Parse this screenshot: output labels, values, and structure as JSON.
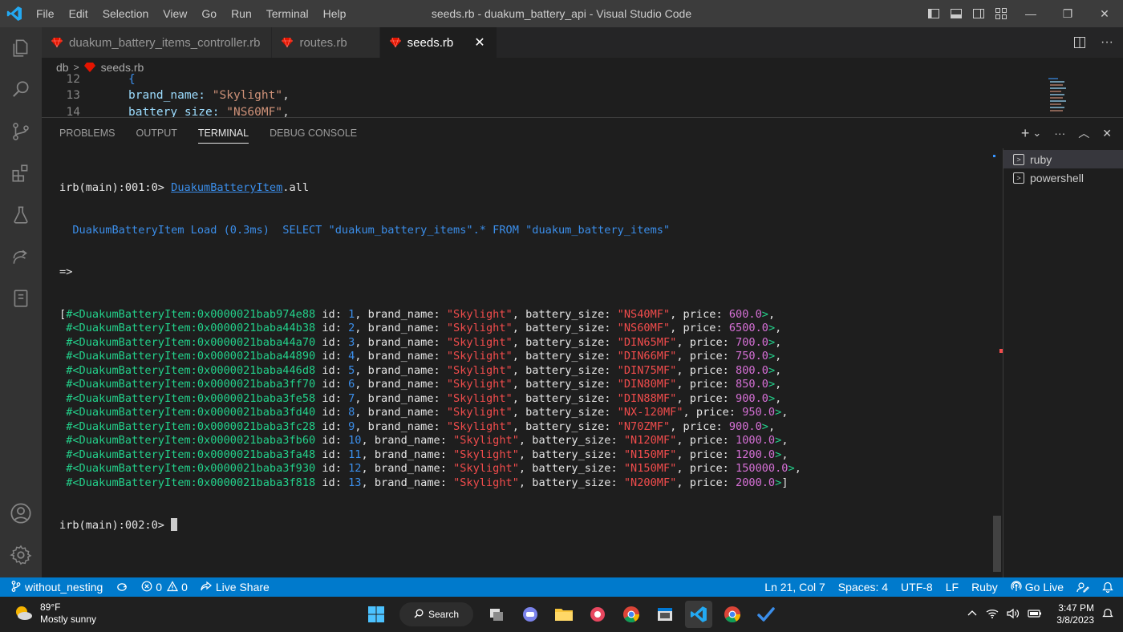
{
  "titlebar": {
    "menu": [
      "File",
      "Edit",
      "Selection",
      "View",
      "Go",
      "Run",
      "Terminal",
      "Help"
    ],
    "window_title": "seeds.rb - duakum_battery_api - Visual Studio Code",
    "win_minimize": "—",
    "win_restore": "❐",
    "win_close": "✕"
  },
  "activitybar": {
    "icons": [
      "explorer-icon",
      "search-icon",
      "source-control-icon",
      "extensions-icon",
      "testing-icon",
      "remote-icon",
      "notebook-icon",
      "account-icon",
      "settings-gear-icon"
    ]
  },
  "tabs": [
    {
      "label": "duakum_battery_items_controller.rb",
      "active": false
    },
    {
      "label": "routes.rb",
      "active": false
    },
    {
      "label": "seeds.rb",
      "active": true
    }
  ],
  "tab_close": "✕",
  "breadcrumb": {
    "folder": "db",
    "sep": ">",
    "file": "seeds.rb"
  },
  "editor": {
    "lines": [
      {
        "num": "12",
        "text": "{"
      },
      {
        "num": "13",
        "key": "brand_name:",
        "val": "\"Skylight\"",
        "punc": ","
      },
      {
        "num": "14",
        "key": "battery_size:",
        "val": "\"NS60MF\"",
        "punc": ","
      }
    ]
  },
  "panel": {
    "tabs": [
      "PROBLEMS",
      "OUTPUT",
      "TERMINAL",
      "DEBUG CONSOLE"
    ],
    "active_tab": "TERMINAL",
    "actions": {
      "add": "+",
      "dropdown": "⌄",
      "more": "···",
      "maximize": "︿",
      "close": "✕"
    }
  },
  "terminal": {
    "prompt1": "irb(main):001:0> ",
    "command_class": "DuakumBatteryItem",
    "command_rest": ".all",
    "sql_label": "  DuakumBatteryItem Load (0.3ms)  ",
    "sql_query": "SELECT \"duakum_battery_items\".* FROM \"duakum_battery_items\"",
    "arrow": "=>",
    "records": [
      {
        "addr": "#<DuakumBatteryItem:0x0000021bab974e88",
        "id": "1",
        "brand": "\"Skylight\"",
        "size": "\"NS40MF\"",
        "price": "600.0"
      },
      {
        "addr": "#<DuakumBatteryItem:0x0000021baba44b38",
        "id": "2",
        "brand": "\"Skylight\"",
        "size": "\"NS60MF\"",
        "price": "6500.0"
      },
      {
        "addr": "#<DuakumBatteryItem:0x0000021baba44a70",
        "id": "3",
        "brand": "\"Skylight\"",
        "size": "\"DIN65MF\"",
        "price": "700.0"
      },
      {
        "addr": "#<DuakumBatteryItem:0x0000021baba44890",
        "id": "4",
        "brand": "\"Skylight\"",
        "size": "\"DIN66MF\"",
        "price": "750.0"
      },
      {
        "addr": "#<DuakumBatteryItem:0x0000021baba446d8",
        "id": "5",
        "brand": "\"Skylight\"",
        "size": "\"DIN75MF\"",
        "price": "800.0"
      },
      {
        "addr": "#<DuakumBatteryItem:0x0000021baba3ff70",
        "id": "6",
        "brand": "\"Skylight\"",
        "size": "\"DIN80MF\"",
        "price": "850.0"
      },
      {
        "addr": "#<DuakumBatteryItem:0x0000021baba3fe58",
        "id": "7",
        "brand": "\"Skylight\"",
        "size": "\"DIN88MF\"",
        "price": "900.0"
      },
      {
        "addr": "#<DuakumBatteryItem:0x0000021baba3fd40",
        "id": "8",
        "brand": "\"Skylight\"",
        "size": "\"NX-120MF\"",
        "price": "950.0"
      },
      {
        "addr": "#<DuakumBatteryItem:0x0000021baba3fc28",
        "id": "9",
        "brand": "\"Skylight\"",
        "size": "\"N70ZMF\"",
        "price": "900.0"
      },
      {
        "addr": "#<DuakumBatteryItem:0x0000021baba3fb60",
        "id": "10",
        "brand": "\"Skylight\"",
        "size": "\"N120MF\"",
        "price": "1000.0"
      },
      {
        "addr": "#<DuakumBatteryItem:0x0000021baba3fa48",
        "id": "11",
        "brand": "\"Skylight\"",
        "size": "\"N150MF\"",
        "price": "1200.0"
      },
      {
        "addr": "#<DuakumBatteryItem:0x0000021baba3f930",
        "id": "12",
        "brand": "\"Skylight\"",
        "size": "\"N150MF\"",
        "price": "150000.0"
      },
      {
        "addr": "#<DuakumBatteryItem:0x0000021baba3f818",
        "id": "13",
        "brand": "\"Skylight\"",
        "size": "\"N200MF\"",
        "price": "2000.0"
      }
    ],
    "prompt2": "irb(main):002:0> "
  },
  "terminal_list": [
    {
      "label": "ruby",
      "selected": true
    },
    {
      "label": "powershell",
      "selected": false
    }
  ],
  "statusbar": {
    "branch": "without_nesting",
    "errors": "0",
    "warnings": "0",
    "live_share": "Live Share",
    "position": "Ln 21, Col 7",
    "spaces": "Spaces: 4",
    "encoding": "UTF-8",
    "eol": "LF",
    "language": "Ruby",
    "go_live": "Go Live"
  },
  "taskbar": {
    "temp": "89°F",
    "weather": "Mostly sunny",
    "search": "Search",
    "time": "3:47 PM",
    "date": "3/8/2023"
  },
  "colors": {
    "accent": "#007acc",
    "ruby_red": "#e51400",
    "term_green": "#23d18b",
    "term_blue": "#3b8eea",
    "term_string": "#f14c4c",
    "term_number": "#d670d6"
  }
}
